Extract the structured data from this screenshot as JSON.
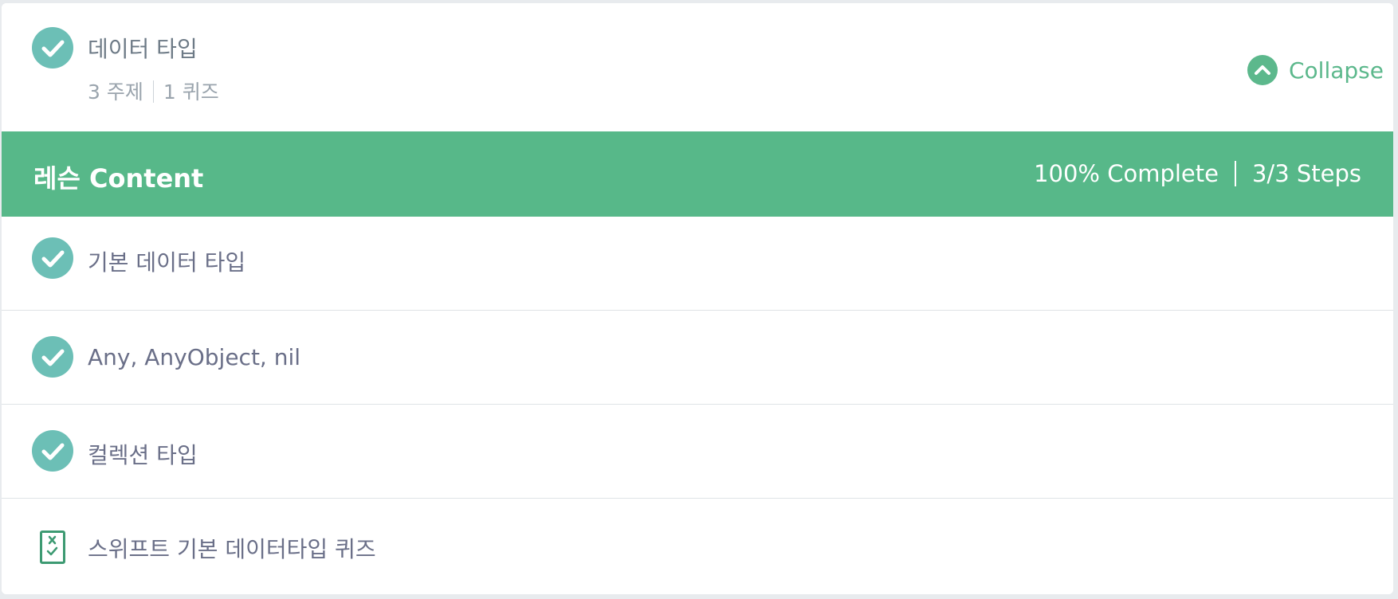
{
  "topic": {
    "title": "데이터 타입",
    "topics_count": "3 주제",
    "quiz_count": "1 퀴즈",
    "collapse_label": "Collapse"
  },
  "lesson_bar": {
    "title": "레슨 Content",
    "percent_complete": "100% Complete",
    "steps": "3/3 Steps"
  },
  "items": [
    {
      "label": "기본 데이터 타입",
      "icon": "check-circle-icon",
      "completed": true
    },
    {
      "label": "Any, AnyObject, nil",
      "icon": "check-circle-icon",
      "completed": true
    },
    {
      "label": "컬렉션 타입",
      "icon": "check-circle-icon",
      "completed": true
    },
    {
      "label": "스위프트 기본 데이터타입 퀴즈",
      "icon": "quiz-icon",
      "completed": false
    }
  ],
  "colors": {
    "accent_green": "#57b889",
    "check_teal": "#6cbfb6",
    "quiz_green": "#3d9a72"
  }
}
